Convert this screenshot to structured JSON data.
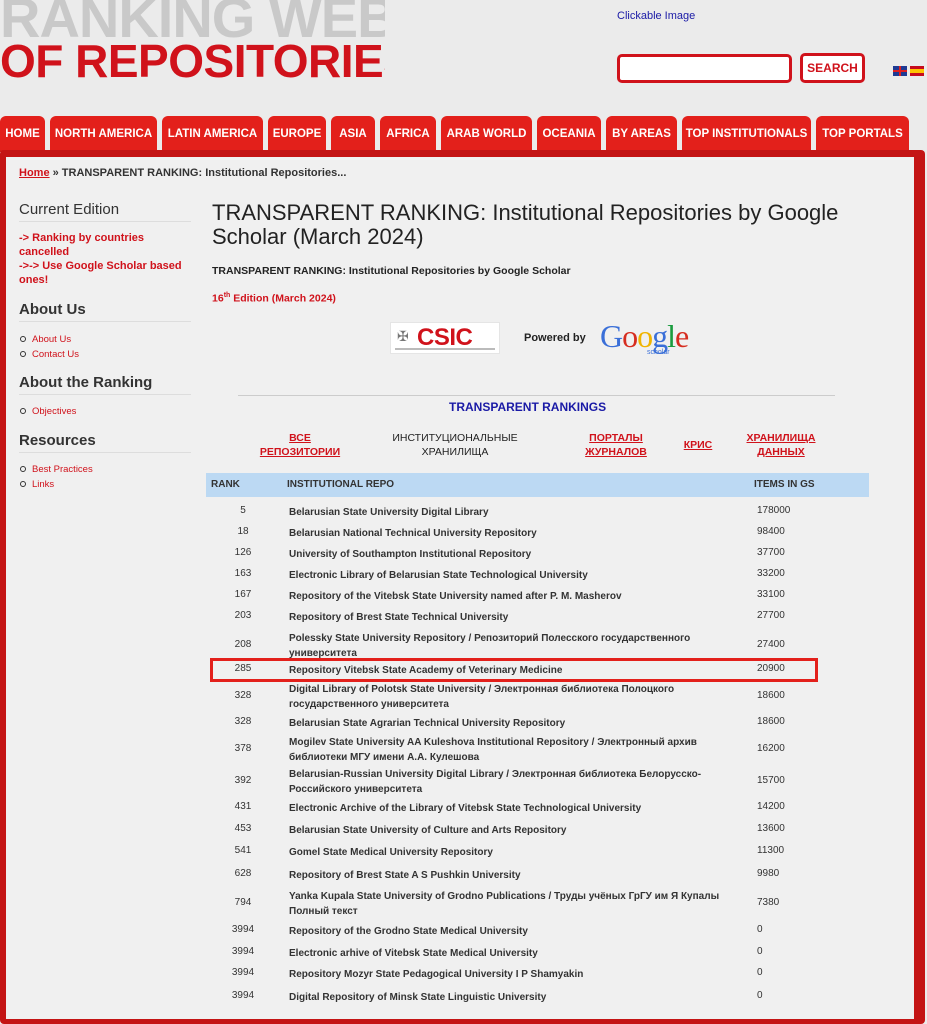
{
  "header": {
    "logo_line1": "RANKING WEB",
    "logo_line2": "OF REPOSITORIES",
    "clickable_image": "Clickable Image",
    "search_button": "SEARCH",
    "search_value": ""
  },
  "nav": {
    "tabs": [
      {
        "label": "HOME"
      },
      {
        "label": "NORTH AMERICA"
      },
      {
        "label": "LATIN AMERICA"
      },
      {
        "label": "EUROPE"
      },
      {
        "label": "ASIA"
      },
      {
        "label": "AFRICA"
      },
      {
        "label": "ARAB WORLD"
      },
      {
        "label": "OCEANIA"
      },
      {
        "label": "BY AREAS"
      },
      {
        "label": "TOP INSTITUTIONALS"
      },
      {
        "label": "TOP PORTALS"
      }
    ]
  },
  "breadcrumb": {
    "home": "Home",
    "separator": " » ",
    "current": "TRANSPARENT RANKING: Institutional Repositories..."
  },
  "sidebar": {
    "current_edition": "Current Edition",
    "notice1": "-> Ranking by countries cancelled",
    "notice2": "->-> Use Google Scholar based ones!",
    "about_us_heading": "About Us",
    "about_us_links": [
      "About Us",
      "Contact Us"
    ],
    "about_ranking_heading": "About the Ranking",
    "about_ranking_links": [
      "Objectives"
    ],
    "resources_heading": "Resources",
    "resources_links": [
      "Best Practices",
      "Links"
    ]
  },
  "content": {
    "title": "TRANSPARENT RANKING: Institutional Repositories by Google Scholar (March 2024)",
    "subtitle": "TRANSPARENT RANKING: Institutional Repositories by Google Scholar",
    "edition_num": "16",
    "edition_sup": "th",
    "edition_rest": " Edition (March 2024)",
    "csic_logo": "CSIC",
    "powered_by": "Powered by",
    "google_logo": "Google",
    "scholar": "scholar",
    "transparent_rankings": "TRANSPARENT RANKINGS",
    "ranking_tabs": [
      {
        "label": "ВСЕ\nРЕПОЗИТОРИИ"
      },
      {
        "label": "ИНСТИТУЦИОНАЛЬНЫЕ\nХРАНИЛИЩА"
      },
      {
        "label": "ПОРТАЛЫ\nЖУРНАЛОВ"
      },
      {
        "label": "КРИС"
      },
      {
        "label": "ХРАНИЛИЩА\nДАННЫХ"
      }
    ]
  },
  "table": {
    "headers": {
      "rank": "RANK",
      "repo": "INSTITUTIONAL REPO",
      "items": "ITEMS IN GS"
    },
    "rows": [
      {
        "rank": "5",
        "repo": "Belarusian State University Digital Library",
        "items": "178000"
      },
      {
        "rank": "18",
        "repo": "Belarusian National Technical University Repository",
        "items": "98400"
      },
      {
        "rank": "126",
        "repo": "University of Southampton Institutional Repository",
        "items": "37700"
      },
      {
        "rank": "163",
        "repo": "Electronic Library of Belarusian State Technological University",
        "items": "33200"
      },
      {
        "rank": "167",
        "repo": "Repository of the Vitebsk State University named after P. M. Masherov",
        "items": "33100"
      },
      {
        "rank": "203",
        "repo": "Repository of Brest State Technical University",
        "items": "27700"
      },
      {
        "rank": "208",
        "repo": "Polessky State University Repository / Репозиторий Полесского государственного университета",
        "items": "27400"
      },
      {
        "rank": "285",
        "repo": "Repository Vitebsk State Academy of Veterinary Medicine",
        "items": "20900"
      },
      {
        "rank": "328",
        "repo": "Digital Library of Polotsk State University / Электронная библиотека Полоцкого государственного университета",
        "items": "18600"
      },
      {
        "rank": "328",
        "repo": "Belarusian State Agrarian Technical University Repository",
        "items": "18600"
      },
      {
        "rank": "378",
        "repo": "Mogilev State University AA Kuleshova Institutional Repository / Электронный архив библиотеки МГУ имени А.А. Кулешова",
        "items": "16200"
      },
      {
        "rank": "392",
        "repo": "Belarusian-Russian University Digital Library / Электронная библиотека Белорусско-Российского университета",
        "items": "15700"
      },
      {
        "rank": "431",
        "repo": "Electronic Archive of the Library of Vitebsk State Technological University",
        "items": "14200"
      },
      {
        "rank": "453",
        "repo": "Belarusian State University of Culture and Arts Repository",
        "items": "13600"
      },
      {
        "rank": "541",
        "repo": "Gomel State Medical University Repository",
        "items": "11300"
      },
      {
        "rank": "628",
        "repo": "Repository of Brest State A S Pushkin University",
        "items": "9980"
      },
      {
        "rank": "794",
        "repo": "Yanka Kupala State University of Grodno Publications / Труды учёных ГрГУ им Я Купалы Полный текст",
        "items": "7380"
      },
      {
        "rank": "3994",
        "repo": "Repository of the Grodno State Medical University",
        "items": "0"
      },
      {
        "rank": "3994",
        "repo": "Electronic arhive of Vitebsk State Medical University",
        "items": "0"
      },
      {
        "rank": "3994",
        "repo": "Repository Mozyr State Pedagogical University I P Shamyakin",
        "items": "0"
      },
      {
        "rank": "3994",
        "repo": "Digital Repository of Minsk State Linguistic University",
        "items": "0"
      }
    ]
  }
}
